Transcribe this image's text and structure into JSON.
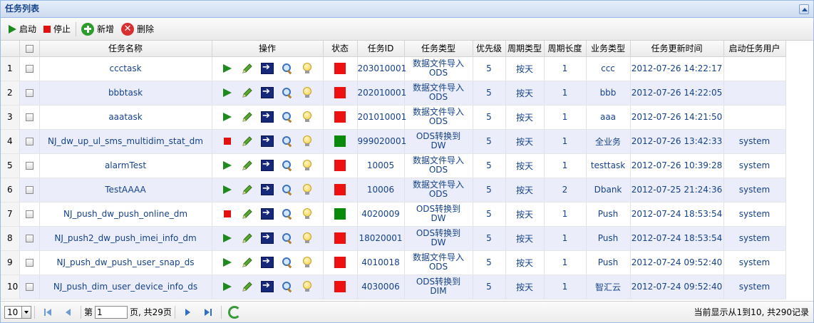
{
  "panel": {
    "title": "任务列表"
  },
  "toolbar": {
    "start": "启动",
    "stop": "停止",
    "add": "新增",
    "delete": "删除"
  },
  "columns": [
    "",
    "",
    "任务名称",
    "操作",
    "状态",
    "任务ID",
    "任务类型",
    "优先级",
    "周期类型",
    "周期长度",
    "业务类型",
    "任务更新时间",
    "启动任务用户"
  ],
  "rows": [
    {
      "n": "1",
      "name": "ccctask",
      "op": "play",
      "status": "#ee1111",
      "id": "203010001",
      "type1": "数据文件导入",
      "type2": "ODS",
      "prio": "5",
      "cycle": "按天",
      "len": "1",
      "biz": "ccc",
      "time": "2012-07-26 14:22:17",
      "user": ""
    },
    {
      "n": "2",
      "name": "bbbtask",
      "op": "play",
      "status": "#ee1111",
      "id": "202010001",
      "type1": "数据文件导入",
      "type2": "ODS",
      "prio": "5",
      "cycle": "按天",
      "len": "1",
      "biz": "bbb",
      "time": "2012-07-26 14:22:05",
      "user": ""
    },
    {
      "n": "3",
      "name": "aaatask",
      "op": "play",
      "status": "#ee1111",
      "id": "201010001",
      "type1": "数据文件导入",
      "type2": "ODS",
      "prio": "5",
      "cycle": "按天",
      "len": "1",
      "biz": "aaa",
      "time": "2012-07-26 14:21:50",
      "user": ""
    },
    {
      "n": "4",
      "name": "NJ_dw_up_ul_sms_multidim_stat_dm",
      "op": "stop",
      "status": "#0a8a0a",
      "id": "999020001",
      "type1": "ODS转换到",
      "type2": "DW",
      "prio": "5",
      "cycle": "按天",
      "len": "1",
      "biz": "全业务",
      "time": "2012-07-26 13:42:33",
      "user": "system"
    },
    {
      "n": "5",
      "name": "alarmTest",
      "op": "play",
      "status": "#ee1111",
      "id": "10005",
      "type1": "数据文件导入",
      "type2": "ODS",
      "prio": "5",
      "cycle": "按天",
      "len": "1",
      "biz": "testtask",
      "time": "2012-07-26 10:39:28",
      "user": "system"
    },
    {
      "n": "6",
      "name": "TestAAAA",
      "op": "play",
      "status": "#ee1111",
      "id": "10006",
      "type1": "数据文件导入",
      "type2": "ODS",
      "prio": "5",
      "cycle": "按天",
      "len": "2",
      "biz": "Dbank",
      "time": "2012-07-25 21:24:36",
      "user": "system"
    },
    {
      "n": "7",
      "name": "NJ_push_dw_push_online_dm",
      "op": "stop",
      "status": "#0a8a0a",
      "id": "4020009",
      "type1": "ODS转换到",
      "type2": "DW",
      "prio": "5",
      "cycle": "按天",
      "len": "1",
      "biz": "Push",
      "time": "2012-07-24 18:53:54",
      "user": "system"
    },
    {
      "n": "8",
      "name": "NJ_push2_dw_push_imei_info_dm",
      "op": "play",
      "status": "#ee1111",
      "id": "18020001",
      "type1": "ODS转换到",
      "type2": "DW",
      "prio": "5",
      "cycle": "按天",
      "len": "1",
      "biz": "Push",
      "time": "2012-07-24 18:53:54",
      "user": "system"
    },
    {
      "n": "9",
      "name": "NJ_push_dw_push_user_snap_ds",
      "op": "play",
      "status": "#ee1111",
      "id": "4010018",
      "type1": "数据文件导入",
      "type2": "ODS",
      "prio": "5",
      "cycle": "按天",
      "len": "1",
      "biz": "Push",
      "time": "2012-07-24 09:52:40",
      "user": "system"
    },
    {
      "n": "10",
      "name": "NJ_push_dim_user_device_info_ds",
      "op": "play",
      "status": "#ee1111",
      "id": "4030006",
      "type1": "ODS转换到",
      "type2": "DIM",
      "prio": "5",
      "cycle": "按天",
      "len": "1",
      "biz": "智汇云",
      "time": "2012-07-24 09:52:40",
      "user": "system"
    }
  ],
  "pager": {
    "page_size": "10",
    "page_label_pre": "第",
    "page_value": "1",
    "page_label_post": "页, 共29页",
    "info": "当前显示从1到10, 共290记录"
  }
}
